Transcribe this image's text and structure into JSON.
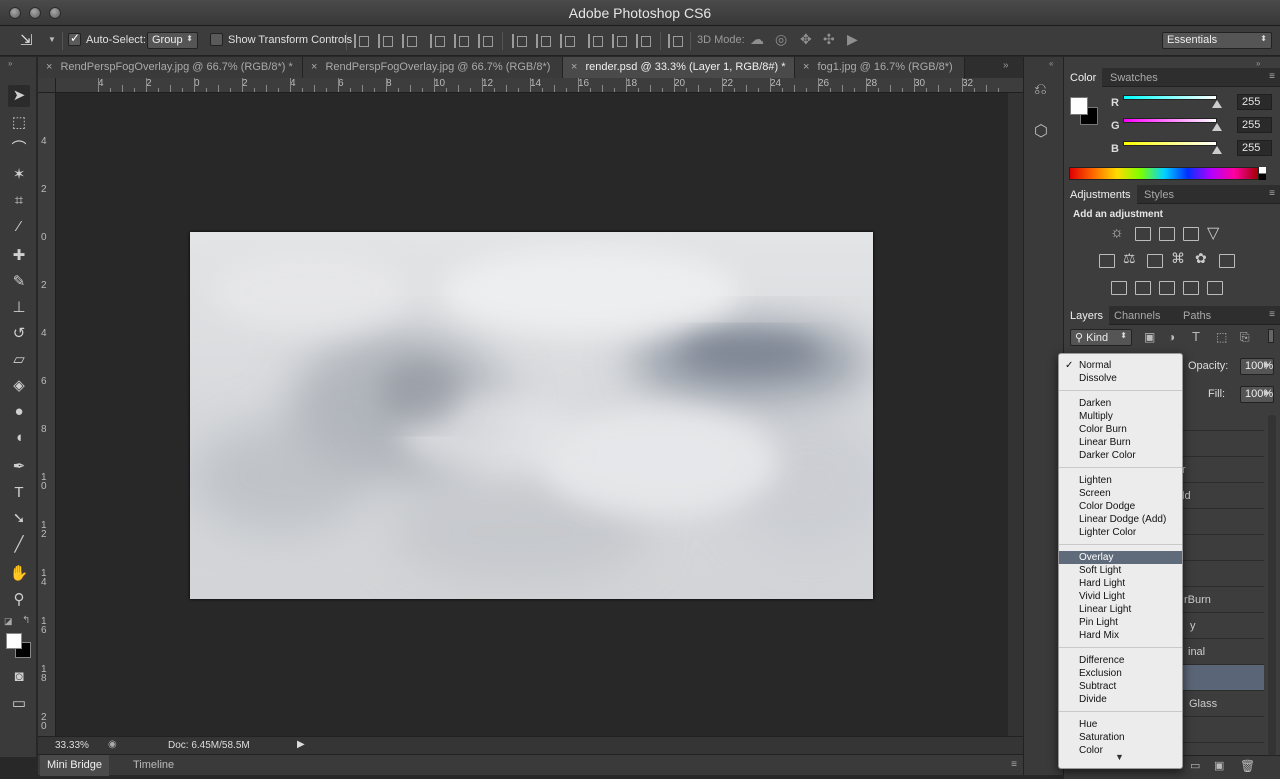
{
  "app": {
    "title": "Adobe Photoshop CS6"
  },
  "options": {
    "auto_select_label": "Auto-Select:",
    "auto_select_value": "Group",
    "show_transform_label": "Show Transform Controls",
    "three_d_mode_label": "3D Mode:",
    "workspace_value": "Essentials"
  },
  "tabs": [
    {
      "label": "RendPerspFogOverlay.jpg @ 66.7% (RGB/8*) *",
      "close": "×"
    },
    {
      "label": "RendPerspFogOverlay.jpg @ 66.7% (RGB/8*)",
      "close": "×"
    },
    {
      "label": "render.psd @ 33.3% (Layer 1, RGB/8#) *",
      "close": "×"
    },
    {
      "label": "fog1.jpg @ 16.7% (RGB/8*)",
      "close": "×"
    }
  ],
  "ruler": {
    "h_labels": [
      "4",
      "2",
      "0",
      "2",
      "4",
      "6",
      "8",
      "10",
      "12",
      "14",
      "16",
      "18",
      "20",
      "22",
      "24",
      "26",
      "28",
      "30",
      "32"
    ],
    "v_labels": [
      "4",
      "2",
      "0",
      "2",
      "4",
      "6",
      "8",
      "10",
      "12",
      "14",
      "16",
      "18",
      "20"
    ]
  },
  "status": {
    "zoom": "33.33%",
    "doc": "Doc: 6.45M/58.5M"
  },
  "bottom_tabs": [
    "Mini Bridge",
    "Timeline"
  ],
  "color_panel": {
    "tabs": [
      "Color",
      "Swatches"
    ],
    "channels": [
      {
        "label": "R",
        "value": "255",
        "color": "#00ffff"
      },
      {
        "label": "G",
        "value": "255",
        "color": "#ff00ff"
      },
      {
        "label": "B",
        "value": "255",
        "color": "#ffff00"
      }
    ]
  },
  "adjustments_panel": {
    "tabs": [
      "Adjustments",
      "Styles"
    ],
    "heading": "Add an adjustment"
  },
  "layers_panel": {
    "tabs": [
      "Layers",
      "Channels",
      "Paths"
    ],
    "filter_kind": "Kind",
    "opacity_label": "Opacity:",
    "opacity_value": "100%",
    "fill_label": "Fill:",
    "fill_value": "100%",
    "layer_name_fragments": [
      "",
      "",
      "r",
      "ld",
      "",
      "",
      "",
      "rBurn",
      "y",
      "inal",
      "",
      "Glass",
      ""
    ]
  },
  "blend_menu": {
    "groups": [
      [
        "Normal",
        "Dissolve"
      ],
      [
        "Darken",
        "Multiply",
        "Color Burn",
        "Linear Burn",
        "Darker Color"
      ],
      [
        "Lighten",
        "Screen",
        "Color Dodge",
        "Linear Dodge (Add)",
        "Lighter Color"
      ],
      [
        "Overlay",
        "Soft Light",
        "Hard Light",
        "Vivid Light",
        "Linear Light",
        "Pin Light",
        "Hard Mix"
      ],
      [
        "Difference",
        "Exclusion",
        "Subtract",
        "Divide"
      ],
      [
        "Hue",
        "Saturation",
        "Color"
      ]
    ],
    "checked": "Normal",
    "selected": "Overlay",
    "check_glyph": "✓",
    "more_glyph": "▼"
  }
}
